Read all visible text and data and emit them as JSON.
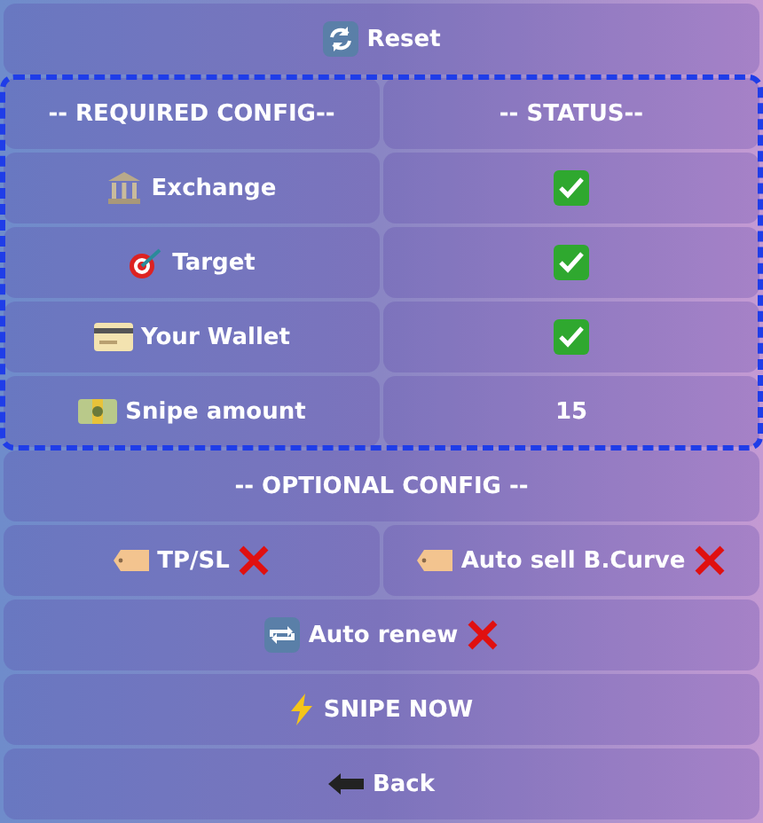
{
  "reset_button": {
    "label": "Reset"
  },
  "required_config": {
    "headers": [
      "-- REQUIRED CONFIG--",
      "-- STATUS--"
    ],
    "rows": [
      {
        "label": "Exchange",
        "status": {
          "kind": "check"
        }
      },
      {
        "label": "Target",
        "status": {
          "kind": "check"
        }
      },
      {
        "label": "Your Wallet",
        "status": {
          "kind": "check"
        }
      },
      {
        "label": "Snipe amount",
        "status": {
          "kind": "text",
          "text": "15"
        }
      }
    ]
  },
  "optional_config": {
    "header": "-- OPTIONAL CONFIG --",
    "options": [
      {
        "label": "TP/SL",
        "enabled": false
      },
      {
        "label": "Auto sell B.Curve",
        "enabled": false
      }
    ],
    "auto_renew": {
      "label": "Auto renew",
      "enabled": false
    }
  },
  "snipe_button": {
    "label": "SNIPE NOW"
  },
  "back_button": {
    "label": "Back"
  }
}
